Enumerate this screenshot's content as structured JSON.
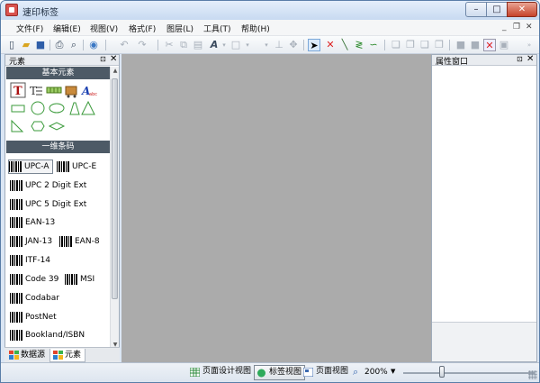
{
  "window": {
    "title": "速印标签"
  },
  "menu": [
    "文件(F)",
    "编辑(E)",
    "视图(V)",
    "格式(F)",
    "图层(L)",
    "工具(T)",
    "帮助(H)"
  ],
  "mdi_controls": {
    "minimize": "_",
    "restore": "❐",
    "close": "✕"
  },
  "left_panel": {
    "title": "元素",
    "section_basic": "基本元素",
    "section_barcode": "一维条码",
    "barcodes": [
      "UPC-A",
      "UPC-E",
      "UPC 2 Digit Ext",
      "UPC 5 Digit Ext",
      "EAN-13",
      "JAN-13",
      "EAN-8",
      "ITF-14",
      "Code 39",
      "MSI",
      "Codabar",
      "PostNet",
      "Bookland/ISBN"
    ],
    "selected_barcode": "UPC-A",
    "tabs": [
      "数据源",
      "元素"
    ],
    "active_tab": "元素"
  },
  "right_panel": {
    "title": "属性窗口"
  },
  "status": {
    "views": [
      "页面设计视图",
      "标签视图",
      "页面视图"
    ],
    "active_view": "标签视图",
    "zoom": "200%"
  },
  "colors": {
    "section_band": "#4d5a66",
    "canvas": "#ababab",
    "accent": "#dcebfb"
  }
}
